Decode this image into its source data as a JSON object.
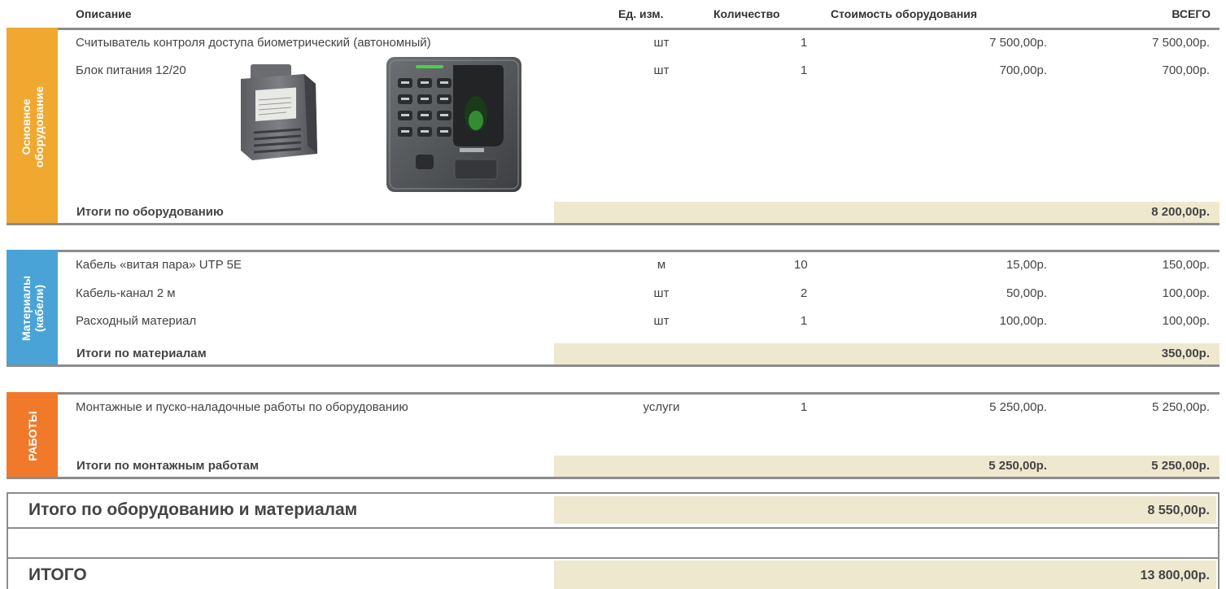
{
  "header": {
    "description": "Описание",
    "unit": "Ед. изм.",
    "quantity": "Количество",
    "equipment_cost": "Стоимость оборудования",
    "total": "ВСЕГО"
  },
  "equipment": {
    "side_label_line1": "Основное",
    "side_label_line2": "оборудование",
    "side_color": "#f0a830",
    "rows": [
      {
        "description": "Считыватель контроля доступа биометрический (автономный)",
        "unit": "шт",
        "quantity": "1",
        "price": "7 500,00р.",
        "total": "7 500,00р."
      },
      {
        "description": "Блок питания 12/20",
        "unit": "шт",
        "quantity": "1",
        "price": "700,00р.",
        "total": "700,00р."
      }
    ],
    "subtotal_label": "Итоги по оборудованию",
    "subtotal_value": "8 200,00р.",
    "images": [
      "power-supply-image",
      "biometric-reader-image"
    ]
  },
  "materials": {
    "side_label_line1": "Материалы",
    "side_label_line2": "(кабели)",
    "side_color": "#4aa3d6",
    "rows": [
      {
        "description": "Кабель «витая пара» UTP 5E",
        "unit": "м",
        "quantity": "10",
        "price": "15,00р.",
        "total": "150,00р."
      },
      {
        "description": "Кабель-канал 2 м",
        "unit": "шт",
        "quantity": "2",
        "price": "50,00р.",
        "total": "100,00р."
      },
      {
        "description": "Расходный материал",
        "unit": "шт",
        "quantity": "1",
        "price": "100,00р.",
        "total": "100,00р."
      }
    ],
    "subtotal_label": "Итоги по материалам",
    "subtotal_value": "350,00р."
  },
  "works": {
    "side_label": "РАБОТЫ",
    "side_color": "#f07a2a",
    "rows": [
      {
        "description": "Монтажные и пуско-наладочные работы по оборудованию",
        "unit": "услуги",
        "quantity": "1",
        "price": "5 250,00р.",
        "total": "5 250,00р."
      }
    ],
    "subtotal_label": "Итоги по монтажным работам",
    "subtotal_price": "5 250,00р.",
    "subtotal_value": "5 250,00р."
  },
  "grand_totals": {
    "equip_materials_label": "Итого по оборудованию и материалам",
    "equip_materials_value": "8 550,00р.",
    "total_label": "ИТОГО",
    "total_value": "13 800,00р."
  },
  "colors": {
    "border": "#8c8c8c",
    "total_fill": "#eee8cf"
  }
}
